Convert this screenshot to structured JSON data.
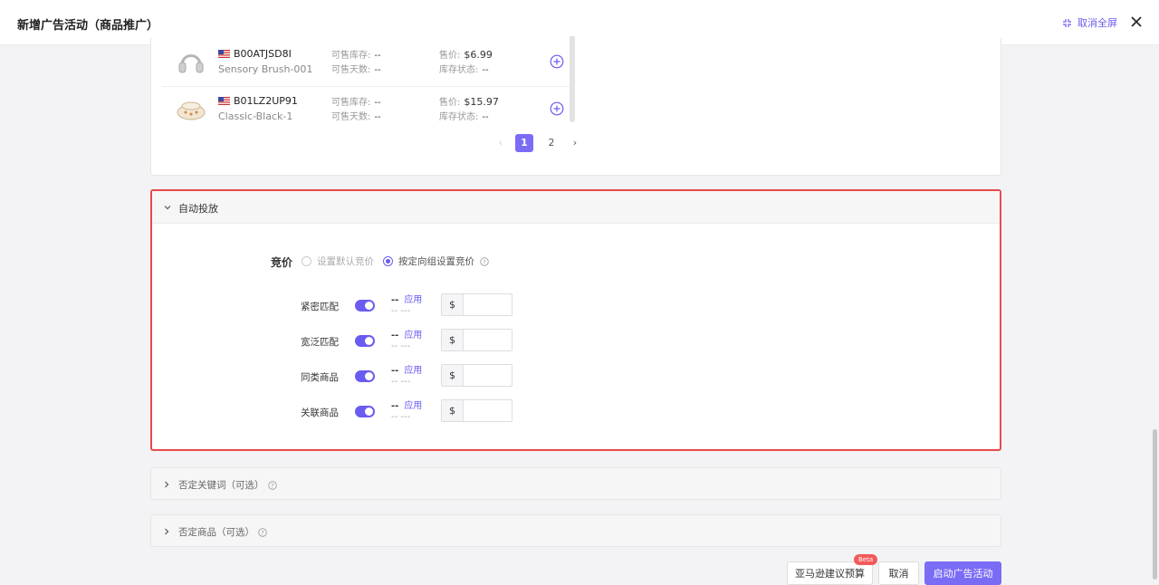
{
  "header": {
    "title": "新增广告活动（商品推广）",
    "exit_fullscreen": "取消全屏"
  },
  "products": [
    {
      "asin": "B00ATJSD8I",
      "sku": "Sensory Brush-001",
      "stock_label": "可售库存:",
      "stock": "--",
      "days_label": "可售天数:",
      "days": "--",
      "price_label": "售价:",
      "price": "$6.99",
      "status_label": "库存状态:",
      "status": "--"
    },
    {
      "asin": "B01LZ2UP91",
      "sku": "Classic-Black-1",
      "stock_label": "可售库存:",
      "stock": "--",
      "days_label": "可售天数:",
      "days": "--",
      "price_label": "售价:",
      "price": "$15.97",
      "status_label": "库存状态:",
      "status": "--"
    }
  ],
  "pagination": {
    "pages": [
      "1",
      "2"
    ],
    "current": "1"
  },
  "auto_targeting": {
    "title": "自动投放",
    "bid_label": "竞价",
    "option_default": "设置默认竞价",
    "option_group": "按定向组设置竞价",
    "rows": [
      {
        "name": "紧密匹配",
        "suggest": "--",
        "apply": "应用",
        "range": "-- ---",
        "currency": "$",
        "value": ""
      },
      {
        "name": "宽泛匹配",
        "suggest": "--",
        "apply": "应用",
        "range": "-- ---",
        "currency": "$",
        "value": ""
      },
      {
        "name": "同类商品",
        "suggest": "--",
        "apply": "应用",
        "range": "-- ---",
        "currency": "$",
        "value": ""
      },
      {
        "name": "关联商品",
        "suggest": "--",
        "apply": "应用",
        "range": "-- ---",
        "currency": "$",
        "value": ""
      }
    ]
  },
  "negative_keywords": {
    "title": "否定关键词（可选）"
  },
  "negative_products": {
    "title": "否定商品（可选）"
  },
  "footer": {
    "amazon_budget": "亚马逊建议预算",
    "beta": "Beta",
    "cancel": "取消",
    "launch": "启动广告活动"
  },
  "colors": {
    "accent": "#6a5cf0",
    "highlight_border": "#e84a4a"
  }
}
